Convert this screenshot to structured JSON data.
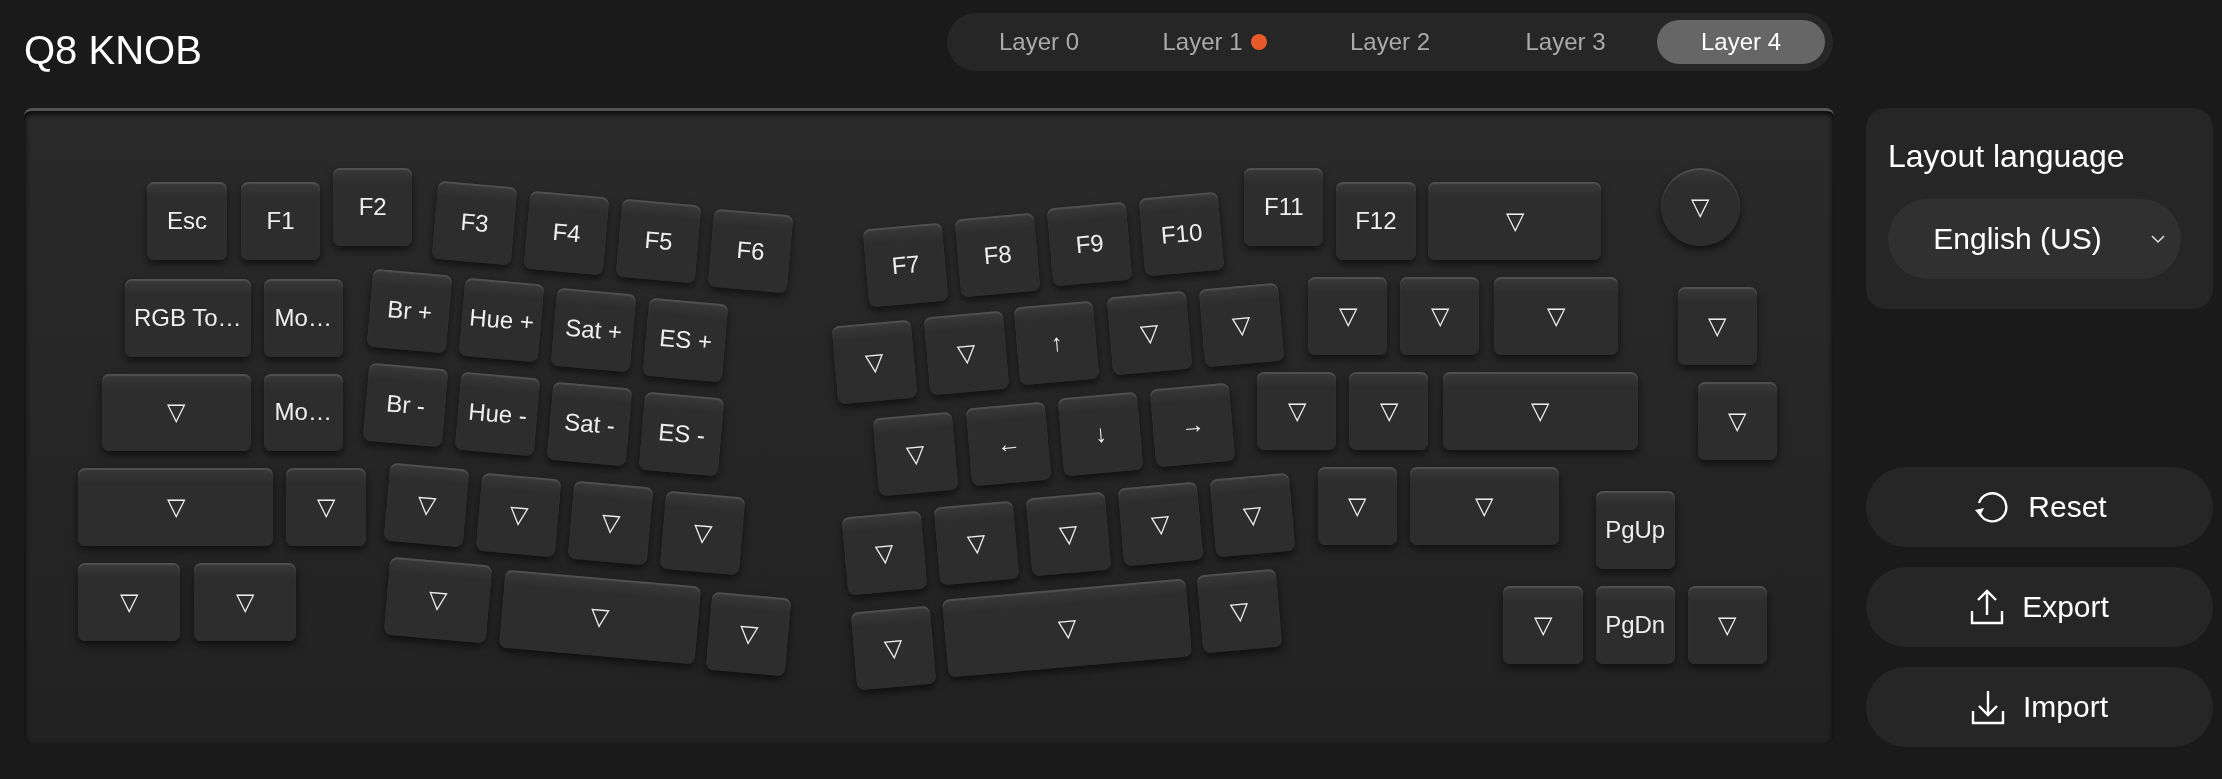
{
  "title": "Q8 KNOB",
  "tabs": [
    {
      "label": "Layer 0",
      "selected": false,
      "modified": false
    },
    {
      "label": "Layer 1",
      "selected": false,
      "modified": true
    },
    {
      "label": "Layer 2",
      "selected": false,
      "modified": false
    },
    {
      "label": "Layer 3",
      "selected": false,
      "modified": false
    },
    {
      "label": "Layer 4",
      "selected": true,
      "modified": false
    }
  ],
  "keys": [
    {
      "label": "Esc",
      "kind": "key"
    },
    {
      "label": "F1",
      "kind": "key"
    },
    {
      "label": "F2",
      "kind": "key"
    },
    {
      "label": "F3",
      "kind": "key"
    },
    {
      "label": "F4",
      "kind": "key"
    },
    {
      "label": "F5",
      "kind": "key"
    },
    {
      "label": "F6",
      "kind": "key"
    },
    {
      "label": "F7",
      "kind": "key"
    },
    {
      "label": "F8",
      "kind": "key"
    },
    {
      "label": "F9",
      "kind": "key"
    },
    {
      "label": "F10",
      "kind": "key"
    },
    {
      "label": "F11",
      "kind": "key"
    },
    {
      "label": "F12",
      "kind": "key"
    },
    {
      "label": "▽",
      "kind": "key"
    },
    {
      "label": "▽",
      "kind": "knob"
    },
    {
      "label": "RGB To…",
      "kind": "key"
    },
    {
      "label": "Mo…",
      "kind": "key"
    },
    {
      "label": "Br +",
      "kind": "key"
    },
    {
      "label": "Hue +",
      "kind": "key"
    },
    {
      "label": "Sat +",
      "kind": "key"
    },
    {
      "label": "ES +",
      "kind": "key"
    },
    {
      "label": "▽",
      "kind": "key"
    },
    {
      "label": "▽",
      "kind": "key"
    },
    {
      "label": "↑",
      "kind": "key"
    },
    {
      "label": "▽",
      "kind": "key"
    },
    {
      "label": "▽",
      "kind": "key"
    },
    {
      "label": "▽",
      "kind": "key"
    },
    {
      "label": "▽",
      "kind": "key"
    },
    {
      "label": "▽",
      "kind": "key"
    },
    {
      "label": "▽",
      "kind": "key"
    },
    {
      "label": "▽",
      "kind": "key"
    },
    {
      "label": "Mo…",
      "kind": "key"
    },
    {
      "label": "Br -",
      "kind": "key"
    },
    {
      "label": "Hue -",
      "kind": "key"
    },
    {
      "label": "Sat -",
      "kind": "key"
    },
    {
      "label": "ES -",
      "kind": "key"
    },
    {
      "label": "▽",
      "kind": "key"
    },
    {
      "label": "←",
      "kind": "key"
    },
    {
      "label": "↓",
      "kind": "key"
    },
    {
      "label": "→",
      "kind": "key"
    },
    {
      "label": "▽",
      "kind": "key"
    },
    {
      "label": "▽",
      "kind": "key"
    },
    {
      "label": "▽",
      "kind": "key"
    },
    {
      "label": "▽",
      "kind": "key"
    },
    {
      "label": "▽",
      "kind": "key"
    },
    {
      "label": "▽",
      "kind": "key"
    },
    {
      "label": "▽",
      "kind": "key"
    },
    {
      "label": "▽",
      "kind": "key"
    },
    {
      "label": "▽",
      "kind": "key"
    },
    {
      "label": "▽",
      "kind": "key"
    },
    {
      "label": "▽",
      "kind": "key"
    },
    {
      "label": "▽",
      "kind": "key"
    },
    {
      "label": "▽",
      "kind": "key"
    },
    {
      "label": "▽",
      "kind": "key"
    },
    {
      "label": "▽",
      "kind": "key"
    },
    {
      "label": "▽",
      "kind": "key"
    },
    {
      "label": "▽",
      "kind": "key"
    },
    {
      "label": "PgUp",
      "kind": "key"
    },
    {
      "label": "▽",
      "kind": "key"
    },
    {
      "label": "▽",
      "kind": "key"
    },
    {
      "label": "▽",
      "kind": "key"
    },
    {
      "label": "▽",
      "kind": "key"
    },
    {
      "label": "▽",
      "kind": "key"
    },
    {
      "label": "▽",
      "kind": "key"
    },
    {
      "label": "▽",
      "kind": "key"
    },
    {
      "label": "▽",
      "kind": "key"
    },
    {
      "label": "▽",
      "kind": "key"
    },
    {
      "label": "PgDn",
      "kind": "key"
    },
    {
      "label": "▽",
      "kind": "key"
    }
  ],
  "language": {
    "label": "Layout language",
    "value": "English (US)"
  },
  "actions": [
    {
      "label": "Reset",
      "kind": "reset"
    },
    {
      "label": "Export",
      "kind": "export"
    },
    {
      "label": "Import",
      "kind": "import"
    }
  ]
}
